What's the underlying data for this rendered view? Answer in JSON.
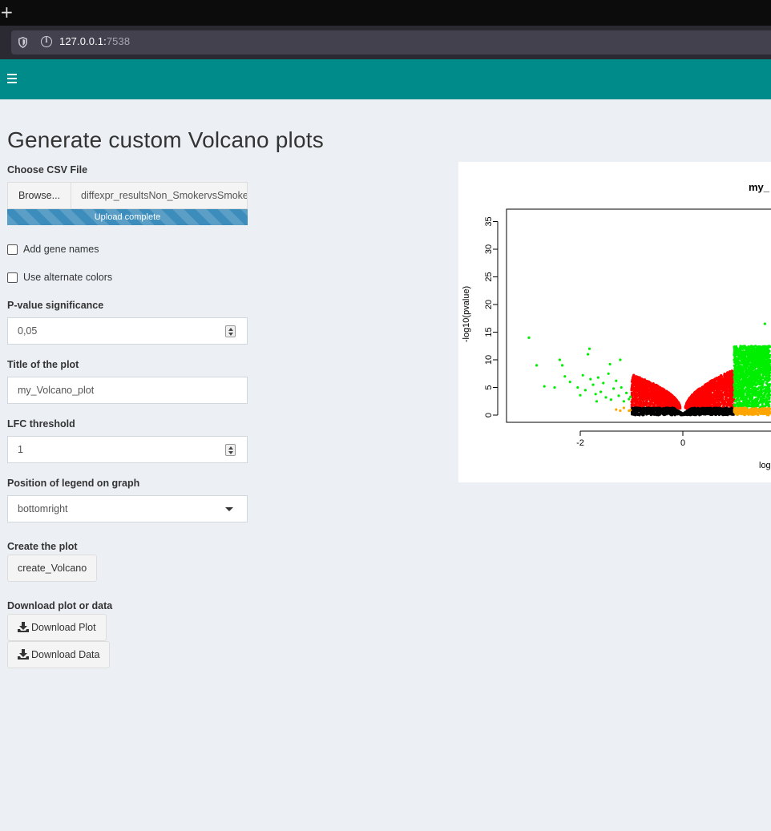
{
  "browser": {
    "new_tab_glyph": "+",
    "url_host": "127.0.0.1:",
    "url_port": "7538",
    "icons": [
      "shield-icon",
      "info-icon"
    ]
  },
  "header": {
    "menu_icon": "hamburger-icon",
    "color": "#008b8b"
  },
  "main": {
    "title": "Generate custom Volcano plots",
    "file_upload": {
      "label": "Choose CSV File",
      "browse_label": "Browse...",
      "file_name": "diffexpr_resultsNon_SmokervsSmoker",
      "progress_text": "Upload complete",
      "progress": 1.0
    },
    "checkboxes": [
      {
        "label": "Add gene names",
        "checked": false
      },
      {
        "label": "Use alternate colors",
        "checked": false
      }
    ],
    "pvalue": {
      "label": "P-value significance",
      "value": "0,05"
    },
    "plot_title": {
      "label": "Title of the plot",
      "value": "my_Volcano_plot"
    },
    "lfc": {
      "label": "LFC threshold",
      "value": "1"
    },
    "legend": {
      "label": "Position of legend on graph",
      "value": "bottomright"
    },
    "create": {
      "label": "Create the plot",
      "button": "create_Volcano"
    },
    "download": {
      "label": "Download plot or data",
      "plot_button": "Download Plot",
      "data_button": "Download Data",
      "icon": "download-icon"
    }
  },
  "chart_data": {
    "type": "scatter",
    "title": "my_",
    "xlabel": "log",
    "ylabel": "-log10(pvalue)",
    "x_ticks": [
      "-2",
      "0"
    ],
    "y_ticks": [
      "0",
      "5",
      "10",
      "15",
      "20",
      "25",
      "30",
      "35"
    ],
    "xlim": [
      -3.3,
      1.7
    ],
    "ylim": [
      -1.3,
      37
    ],
    "grid": false,
    "colors": {
      "not_significant": "#000000",
      "significant_pvalue": "#ff0000",
      "large_lfc": "#ffa500",
      "significant_and_lfc": "#00ee00"
    },
    "series": [
      {
        "color": "#00ee00",
        "values": [
          [
            -3.0,
            14.0
          ],
          [
            -2.85,
            9.0
          ],
          [
            -2.7,
            5.2
          ],
          [
            -2.5,
            5.0
          ],
          [
            -2.4,
            10.0
          ],
          [
            -2.35,
            9.0
          ],
          [
            -2.3,
            7.0
          ],
          [
            -2.2,
            6.0
          ],
          [
            -2.05,
            5.0
          ],
          [
            -2.0,
            3.6
          ],
          [
            -1.95,
            7.2
          ],
          [
            -1.9,
            4.5
          ],
          [
            -1.85,
            11.0
          ],
          [
            -1.82,
            12.0
          ],
          [
            -1.8,
            6.5
          ],
          [
            -1.75,
            5.5
          ],
          [
            -1.7,
            3.8
          ],
          [
            -1.68,
            2.5
          ],
          [
            -1.65,
            6.8
          ],
          [
            -1.6,
            4.2
          ],
          [
            -1.55,
            5.8
          ],
          [
            -1.5,
            3.2
          ],
          [
            -1.45,
            7.5
          ],
          [
            -1.42,
            9.2
          ],
          [
            -1.4,
            2.8
          ],
          [
            -1.35,
            4.8
          ],
          [
            -1.3,
            6.2
          ],
          [
            -1.25,
            3.5
          ],
          [
            -1.22,
            10.0
          ],
          [
            -1.2,
            5.0
          ],
          [
            -1.15,
            2.5
          ],
          [
            -1.1,
            4.0
          ],
          [
            -1.05,
            2.9
          ],
          [
            -1.02,
            3.3
          ],
          [
            1.6,
            16.5
          ]
        ]
      },
      {
        "color": "#ffa500",
        "values": [
          [
            -1.3,
            1.0
          ],
          [
            -1.22,
            0.8
          ],
          [
            -1.15,
            1.3
          ],
          [
            -1.05,
            0.8
          ],
          [
            -1.02,
            0.9
          ]
        ]
      }
    ],
    "clouds": [
      {
        "name": "left-red",
        "color": "#ff0000",
        "x_range": [
          -1.0,
          -0.05
        ],
        "peak": 8.5,
        "density": 1200
      },
      {
        "name": "right-red",
        "color": "#ff0000",
        "x_range": [
          0.05,
          1.0
        ],
        "peak": 9.5,
        "density": 1200
      },
      {
        "name": "black-base",
        "color": "#000000",
        "x_range": [
          -1.0,
          1.0
        ],
        "peak": 1.3,
        "density": 900
      },
      {
        "name": "right-green",
        "color": "#00ee00",
        "x_range": [
          1.0,
          1.7
        ],
        "peak": 12.5,
        "density": 1400
      },
      {
        "name": "right-orange",
        "color": "#ffa500",
        "x_range": [
          1.0,
          1.7
        ],
        "peak": 1.3,
        "density": 260
      }
    ]
  }
}
